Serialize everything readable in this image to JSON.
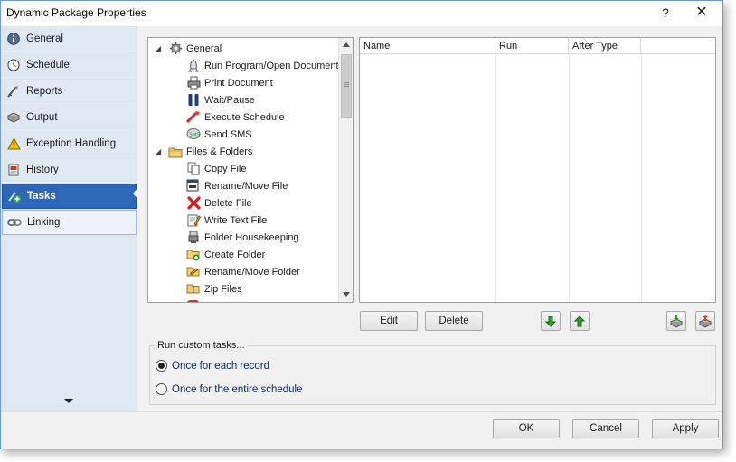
{
  "window": {
    "title": "Dynamic Package Properties",
    "help_label": "?",
    "close_label": "✕"
  },
  "sidebar": {
    "items": [
      {
        "label": "General",
        "icon": "info-icon",
        "state": "normal"
      },
      {
        "label": "Schedule",
        "icon": "clock-icon",
        "state": "normal"
      },
      {
        "label": "Reports",
        "icon": "reports-icon",
        "state": "normal"
      },
      {
        "label": "Output",
        "icon": "output-icon",
        "state": "normal"
      },
      {
        "label": "Exception Handling",
        "icon": "warning-icon",
        "state": "normal"
      },
      {
        "label": "History",
        "icon": "history-icon",
        "state": "normal"
      },
      {
        "label": "Tasks",
        "icon": "tasks-icon",
        "state": "active"
      },
      {
        "label": "Linking",
        "icon": "link-icon",
        "state": "hover"
      }
    ]
  },
  "task_tree": {
    "groups": [
      {
        "label": "General",
        "icon": "gear-icon",
        "expanded": true,
        "items": [
          {
            "label": "Run Program/Open Document",
            "icon": "rocket-icon"
          },
          {
            "label": "Print Document",
            "icon": "printer-icon"
          },
          {
            "label": "Wait/Pause",
            "icon": "pause-icon"
          },
          {
            "label": "Execute Schedule",
            "icon": "execute-icon"
          },
          {
            "label": "Send SMS",
            "icon": "sms-icon"
          }
        ]
      },
      {
        "label": "Files & Folders",
        "icon": "folder-icon",
        "expanded": true,
        "items": [
          {
            "label": "Copy File",
            "icon": "copy-file-icon"
          },
          {
            "label": "Rename/Move File",
            "icon": "rename-file-icon"
          },
          {
            "label": "Delete File",
            "icon": "delete-file-icon"
          },
          {
            "label": "Write Text File",
            "icon": "write-text-icon"
          },
          {
            "label": "Folder Housekeeping",
            "icon": "housekeeping-icon"
          },
          {
            "label": "Create Folder",
            "icon": "create-folder-icon"
          },
          {
            "label": "Rename/Move Folder",
            "icon": "rename-folder-icon"
          },
          {
            "label": "Zip Files",
            "icon": "zip-icon"
          }
        ]
      }
    ]
  },
  "task_list": {
    "columns": [
      "Name",
      "Run",
      "After Type"
    ],
    "rows": []
  },
  "list_buttons": {
    "edit": "Edit",
    "delete": "Delete"
  },
  "run_custom": {
    "title": "Run custom tasks...",
    "options": [
      {
        "label": "Once for each record",
        "selected": true
      },
      {
        "label": "Once for the entire schedule",
        "selected": false
      }
    ]
  },
  "footer": {
    "ok": "OK",
    "cancel": "Cancel",
    "apply": "Apply"
  }
}
